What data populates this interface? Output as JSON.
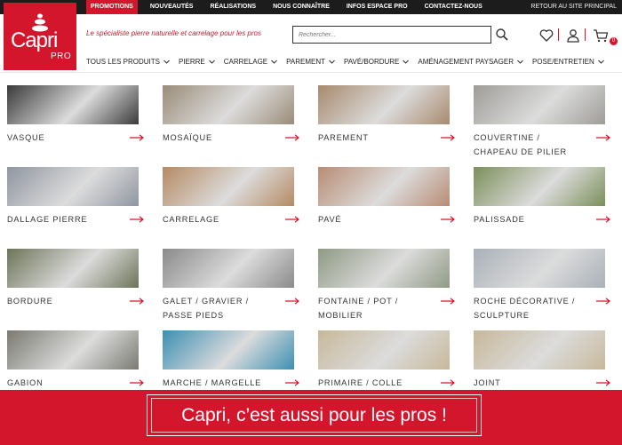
{
  "topbar": {
    "links": [
      "PROMOTIONS",
      "NOUVEAUTÉS",
      "RÉALISATIONS",
      "NOUS CONNAÎTRE",
      "INFOS ESPACE PRO",
      "CONTACTEZ-NOUS"
    ],
    "back_link": "RETOUR AU SITE PRINCIPAL"
  },
  "logo": {
    "brand": "Capri",
    "sub": "PRO"
  },
  "header": {
    "tagline": "Le spécialiste pierre naturelle et carrelage pour les pros",
    "search_placeholder": "Rechercher...",
    "cart_count": "0"
  },
  "mainnav": [
    "TOUS LES PRODUITS",
    "PIERRE",
    "CARRELAGE",
    "PAREMENT",
    "PAVÉ/BORDURE",
    "AMÉNAGEMENT PAYSAGER",
    "POSE/ENTRETIEN"
  ],
  "categories": [
    {
      "label": "VASQUE",
      "color": "#3a3a3a"
    },
    {
      "label": "MOSAÏQUE",
      "color": "#9a8c78"
    },
    {
      "label": "PAREMENT",
      "color": "#a88a6e"
    },
    {
      "label": "COUVERTINE / CHAPEAU DE PILIER",
      "color": "#9d9c97"
    },
    {
      "label": "DALLAGE PIERRE",
      "color": "#8f96a0"
    },
    {
      "label": "CARRELAGE",
      "color": "#b58a63"
    },
    {
      "label": "PAVÉ",
      "color": "#b88c74"
    },
    {
      "label": "PALISSADE",
      "color": "#7b8f5a"
    },
    {
      "label": "BORDURE",
      "color": "#6d7458"
    },
    {
      "label": "GALET / GRAVIER / PASSE PIEDS",
      "color": "#8a8a8a"
    },
    {
      "label": "FONTAINE / POT / MOBILIER",
      "color": "#8f9a84"
    },
    {
      "label": "ROCHE DÉCORATIVE / SCULPTURE",
      "color": "#a9b1b8"
    },
    {
      "label": "GABION",
      "color": "#7a7a72"
    },
    {
      "label": "MARCHE / MARGELLE",
      "color": "#3c8fb3"
    },
    {
      "label": "PRIMAIRE / COLLE",
      "color": "#c7b89a"
    },
    {
      "label": "JOINT",
      "color": "#c7b89a"
    }
  ],
  "banner": {
    "text": "Capri, c’est aussi pour les pros !"
  },
  "colors": {
    "accent": "#d3162b",
    "topbar": "#1c1c1c"
  }
}
